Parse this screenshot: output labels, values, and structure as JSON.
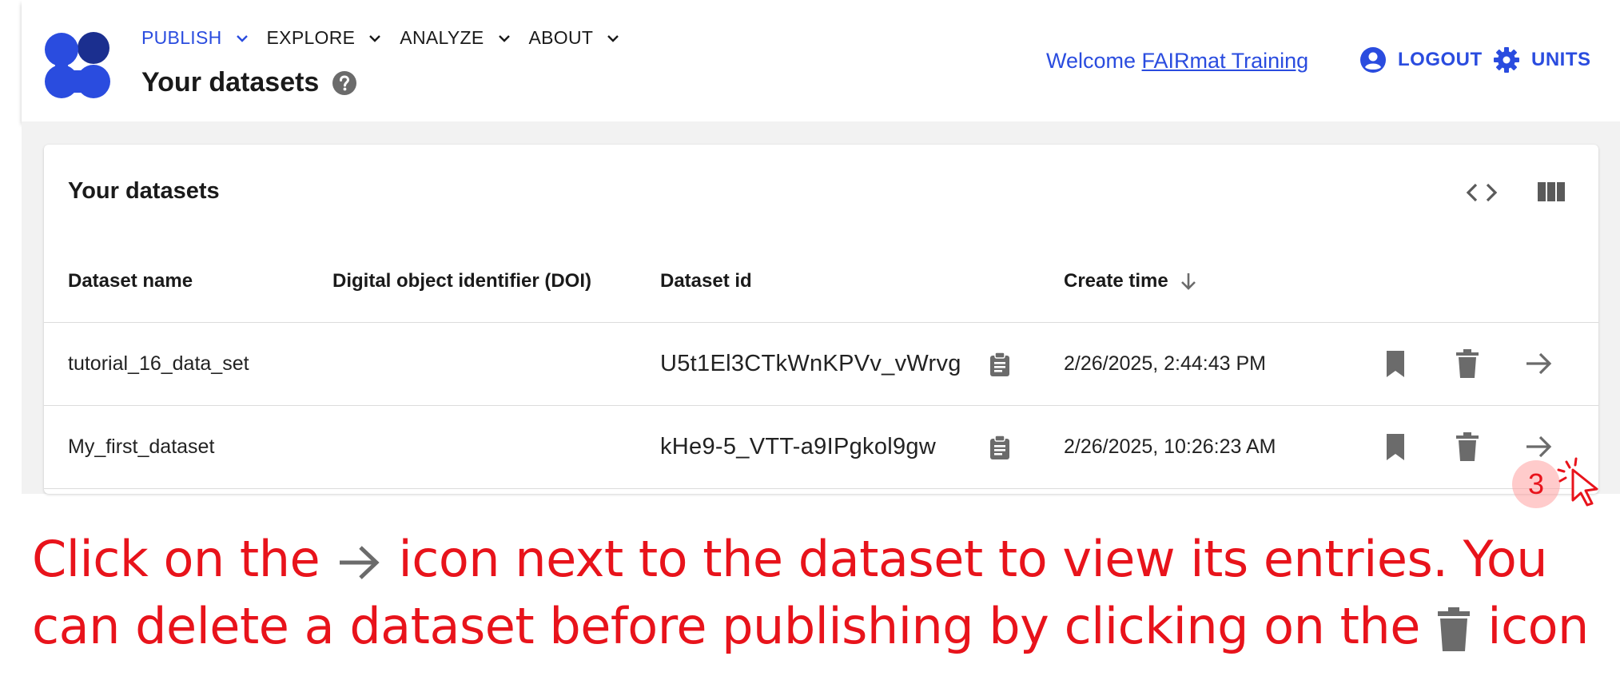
{
  "header": {
    "nav": [
      {
        "label": "PUBLISH",
        "active": true
      },
      {
        "label": "EXPLORE",
        "active": false
      },
      {
        "label": "ANALYZE",
        "active": false
      },
      {
        "label": "ABOUT",
        "active": false
      }
    ],
    "page_title": "Your datasets",
    "welcome_prefix": "Welcome ",
    "user_name": "FAIRmat Training",
    "logout_label": "LOGOUT",
    "units_label": "UNITS"
  },
  "card": {
    "title": "Your datasets",
    "columns": {
      "name": "Dataset name",
      "doi": "Digital object identifier (DOI)",
      "id": "Dataset id",
      "create_time": "Create time"
    },
    "rows": [
      {
        "name": "tutorial_16_data_set",
        "doi": "",
        "id": "U5t1El3CTkWnKPVv_vWrvg",
        "create_time": "2/26/2025, 2:44:43 PM"
      },
      {
        "name": "My_first_dataset",
        "doi": "",
        "id": "kHe9-5_VTT-a9IPgkol9gw",
        "create_time": "2/26/2025, 10:26:23 AM"
      }
    ]
  },
  "annotation": {
    "step_number": "3",
    "text_part1": "Click on the ",
    "text_part2": " icon next to the dataset to view its entries. You can delete a dataset before publishing by clicking on the ",
    "text_part3": " icon"
  },
  "colors": {
    "brand_blue": "#2a4cdf",
    "annotation_red": "#e8131b",
    "icon_gray": "#6b6b6b"
  }
}
